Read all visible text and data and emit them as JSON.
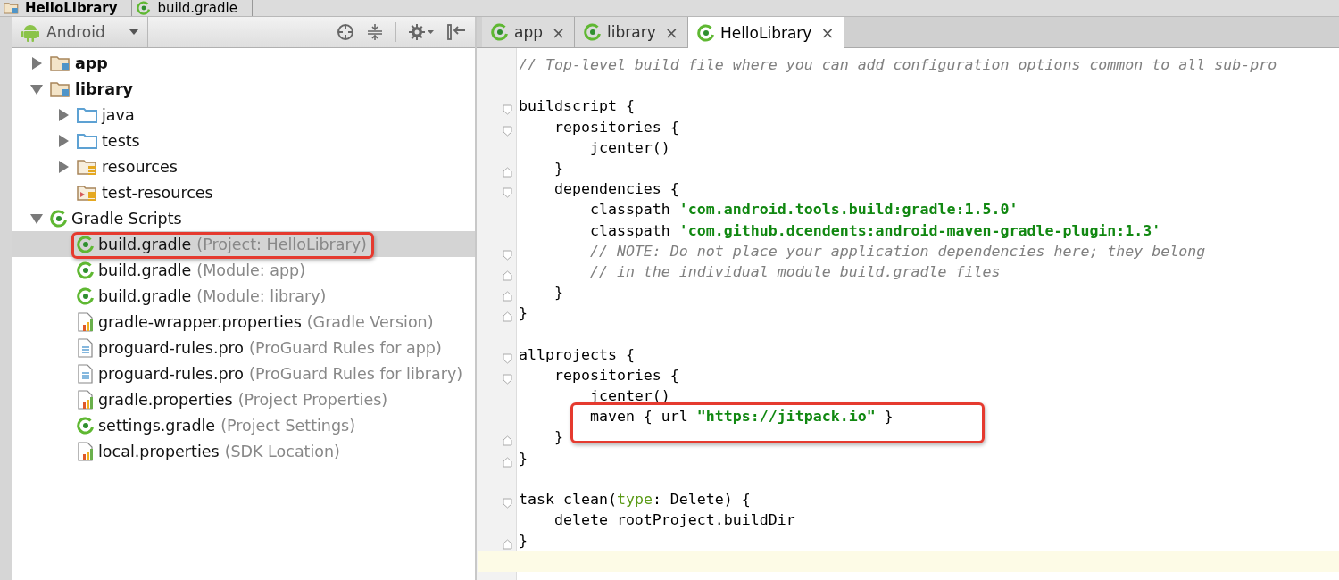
{
  "breadcrumbs": [
    {
      "label": "HelloLibrary",
      "kind": "module"
    },
    {
      "label": "build.gradle",
      "kind": "gradle"
    }
  ],
  "project_panel": {
    "view": "Android",
    "tree": [
      {
        "name": "app",
        "kind": "module",
        "bold": true,
        "expanded": false,
        "selected": false,
        "highlighted": false
      },
      {
        "name": "library",
        "kind": "module",
        "bold": true,
        "expanded": true,
        "selected": false,
        "highlighted": false,
        "children": [
          {
            "name": "java",
            "kind": "source",
            "bold": false,
            "expanded": false,
            "selected": false,
            "highlighted": false
          },
          {
            "name": "tests",
            "kind": "source",
            "bold": false,
            "expanded": false,
            "selected": false,
            "highlighted": false
          },
          {
            "name": "resources",
            "kind": "resources",
            "bold": false,
            "expanded": false,
            "selected": false,
            "highlighted": false
          },
          {
            "name": "test-resources",
            "kind": "test-resources",
            "bold": false,
            "selected": false,
            "highlighted": false
          }
        ]
      },
      {
        "name": "Gradle Scripts",
        "kind": "gradle",
        "bold": false,
        "expanded": true,
        "selected": false,
        "highlighted": false,
        "children": [
          {
            "name": "build.gradle",
            "detail": "(Project: HelloLibrary)",
            "kind": "gradle",
            "bold": false,
            "selected": true,
            "highlighted": true
          },
          {
            "name": "build.gradle",
            "detail": "(Module: app)",
            "kind": "gradle",
            "bold": false,
            "selected": false,
            "highlighted": false
          },
          {
            "name": "build.gradle",
            "detail": "(Module: library)",
            "kind": "gradle",
            "bold": false,
            "selected": false,
            "highlighted": false
          },
          {
            "name": "gradle-wrapper.properties",
            "detail": "(Gradle Version)",
            "kind": "properties",
            "bold": false,
            "selected": false,
            "highlighted": false
          },
          {
            "name": "proguard-rules.pro",
            "detail": "(ProGuard Rules for app)",
            "kind": "text",
            "bold": false,
            "selected": false,
            "highlighted": false
          },
          {
            "name": "proguard-rules.pro",
            "detail": "(ProGuard Rules for library)",
            "kind": "text",
            "bold": false,
            "selected": false,
            "highlighted": false
          },
          {
            "name": "gradle.properties",
            "detail": "(Project Properties)",
            "kind": "properties",
            "bold": false,
            "selected": false,
            "highlighted": false
          },
          {
            "name": "settings.gradle",
            "detail": "(Project Settings)",
            "kind": "gradle",
            "bold": false,
            "selected": false,
            "highlighted": false
          },
          {
            "name": "local.properties",
            "detail": "(SDK Location)",
            "kind": "properties",
            "bold": false,
            "selected": false,
            "highlighted": false
          }
        ]
      }
    ]
  },
  "editor": {
    "tabs": [
      {
        "label": "app",
        "close": "×",
        "selected": false
      },
      {
        "label": "library",
        "close": "×",
        "selected": false
      },
      {
        "label": "HelloLibrary",
        "close": "×",
        "selected": true
      }
    ],
    "lines": [
      {
        "kind": "plain",
        "current": false,
        "highlighted": false,
        "tokens": [
          {
            "kind": "comment",
            "text": "// Top-level build file where you can add configuration options common to all sub-pro"
          }
        ]
      },
      {
        "kind": "plain",
        "current": false,
        "highlighted": false
      },
      {
        "kind": "fold-start",
        "current": false,
        "highlighted": false,
        "tokens": [
          {
            "kind": "plain",
            "text": "buildscript {"
          }
        ]
      },
      {
        "kind": "fold-start",
        "current": false,
        "highlighted": false,
        "tokens": [
          {
            "kind": "plain",
            "text": "    repositories {"
          }
        ]
      },
      {
        "kind": "plain",
        "current": false,
        "highlighted": false,
        "tokens": [
          {
            "kind": "plain",
            "text": "        jcenter()"
          }
        ]
      },
      {
        "kind": "fold-end",
        "current": false,
        "highlighted": false,
        "tokens": [
          {
            "kind": "plain",
            "text": "    }"
          }
        ]
      },
      {
        "kind": "fold-start",
        "current": false,
        "highlighted": false,
        "tokens": [
          {
            "kind": "plain",
            "text": "    dependencies {"
          }
        ]
      },
      {
        "kind": "plain",
        "current": false,
        "highlighted": false,
        "tokens": [
          {
            "kind": "plain",
            "text": "        classpath "
          },
          {
            "kind": "string",
            "text": "'com.android.tools.build:gradle:1.5.0'"
          }
        ]
      },
      {
        "kind": "plain",
        "current": false,
        "highlighted": false,
        "tokens": [
          {
            "kind": "plain",
            "text": "        classpath "
          },
          {
            "kind": "string",
            "text": "'com.github.dcendents:android-maven-gradle-plugin:1.3'"
          }
        ]
      },
      {
        "kind": "fold-start",
        "current": false,
        "highlighted": false,
        "tokens": [
          {
            "kind": "comment",
            "text": "        // NOTE: Do not place your application dependencies here; they belong"
          }
        ]
      },
      {
        "kind": "fold-end",
        "current": false,
        "highlighted": false,
        "tokens": [
          {
            "kind": "comment",
            "text": "        // in the individual module build.gradle files"
          }
        ]
      },
      {
        "kind": "fold-end",
        "current": false,
        "highlighted": false,
        "tokens": [
          {
            "kind": "plain",
            "text": "    }"
          }
        ]
      },
      {
        "kind": "fold-end",
        "current": false,
        "highlighted": false,
        "tokens": [
          {
            "kind": "plain",
            "text": "}"
          }
        ]
      },
      {
        "kind": "plain",
        "current": false,
        "highlighted": false
      },
      {
        "kind": "fold-start",
        "current": false,
        "highlighted": false,
        "tokens": [
          {
            "kind": "plain",
            "text": "allprojects {"
          }
        ]
      },
      {
        "kind": "fold-start",
        "current": false,
        "highlighted": false,
        "tokens": [
          {
            "kind": "plain",
            "text": "    repositories {"
          }
        ]
      },
      {
        "kind": "plain",
        "current": false,
        "highlighted": false,
        "tokens": [
          {
            "kind": "plain",
            "text": "        jcenter()"
          }
        ]
      },
      {
        "kind": "plain",
        "current": false,
        "highlighted": true,
        "tokens": [
          {
            "kind": "plain",
            "text": "        maven { url "
          },
          {
            "kind": "string",
            "text": "\"https://jitpack.io\""
          },
          {
            "kind": "plain",
            "text": " }"
          }
        ]
      },
      {
        "kind": "fold-end",
        "current": false,
        "highlighted": false,
        "tokens": [
          {
            "kind": "plain",
            "text": "    }"
          }
        ]
      },
      {
        "kind": "fold-end",
        "current": false,
        "highlighted": false,
        "tokens": [
          {
            "kind": "plain",
            "text": "}"
          }
        ]
      },
      {
        "kind": "plain",
        "current": false,
        "highlighted": false
      },
      {
        "kind": "fold-start",
        "current": false,
        "highlighted": false,
        "tokens": [
          {
            "kind": "plain",
            "text": "task clean("
          },
          {
            "kind": "param",
            "text": "type"
          },
          {
            "kind": "plain",
            "text": ": Delete) {"
          }
        ]
      },
      {
        "kind": "plain",
        "current": false,
        "highlighted": false,
        "tokens": [
          {
            "kind": "plain",
            "text": "    delete rootProject.buildDir"
          }
        ]
      },
      {
        "kind": "fold-end",
        "current": false,
        "highlighted": false,
        "tokens": [
          {
            "kind": "plain",
            "text": "}"
          }
        ]
      },
      {
        "kind": "plain",
        "current": true,
        "highlighted": false
      }
    ]
  }
}
